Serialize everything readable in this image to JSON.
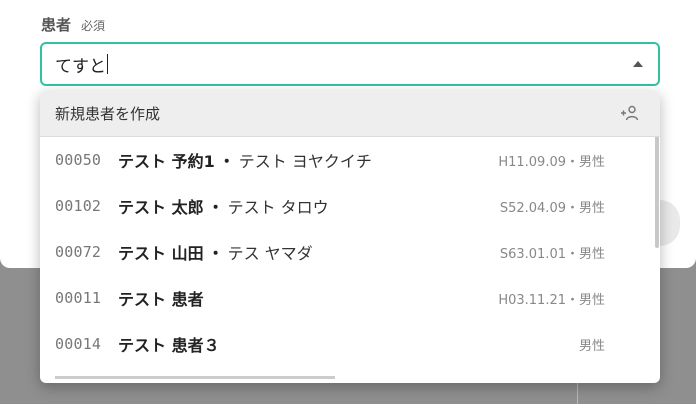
{
  "form": {
    "label": "患者",
    "required": "必須",
    "input_value": "てすと"
  },
  "dropdown": {
    "create_label": "新規患者を作成",
    "items": [
      {
        "id": "00050",
        "name": "テスト 予約1",
        "kana": "テスト ヨヤクイチ",
        "meta": "H11.09.09・男性"
      },
      {
        "id": "00102",
        "name": "テスト 太郎",
        "kana": "テスト タロウ",
        "meta": "S52.04.09・男性"
      },
      {
        "id": "00072",
        "name": "テスト 山田",
        "kana": "テス ヤマダ",
        "meta": "S63.01.01・男性"
      },
      {
        "id": "00011",
        "name": "テスト 患者",
        "kana": "",
        "meta": "H03.11.21・男性"
      },
      {
        "id": "00014",
        "name": "テスト 患者３",
        "kana": "",
        "meta": "男性"
      }
    ]
  },
  "colors": {
    "focus_border": "#2fc4a0",
    "backdrop": "#8f8f8f"
  }
}
